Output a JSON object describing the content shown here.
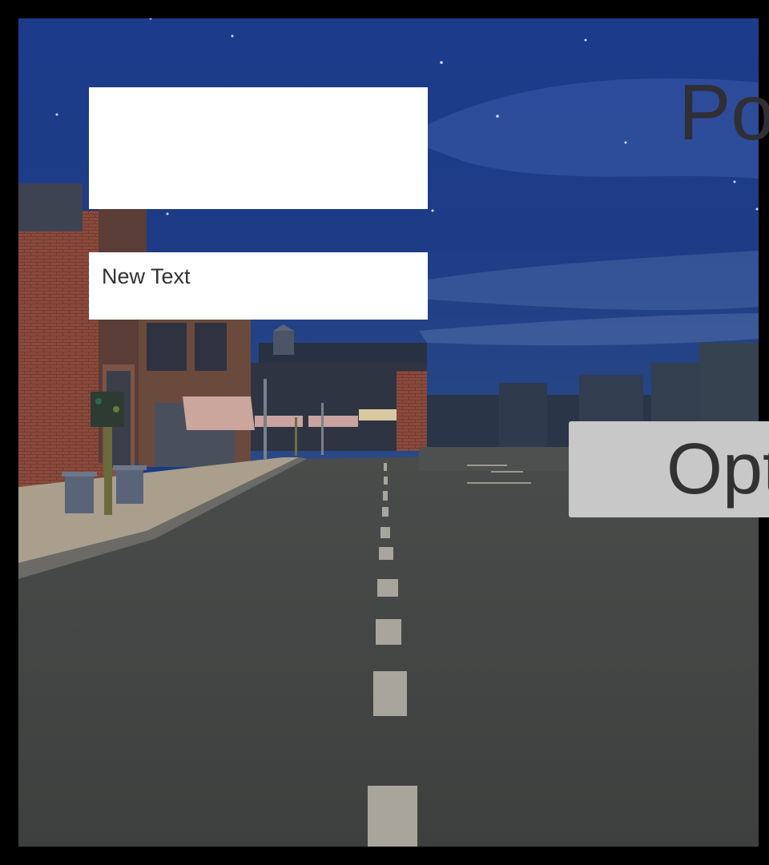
{
  "scene": {
    "description_icon": "city-street-night-scene"
  },
  "ui": {
    "text_label": "New Text",
    "title_fragment": "Po",
    "options_button_label": "Opt"
  },
  "colors": {
    "sky": "#1b3a86",
    "road": "#3f4140",
    "panel": "#ffffff",
    "button": "#c8c8c8",
    "text": "#323232"
  }
}
